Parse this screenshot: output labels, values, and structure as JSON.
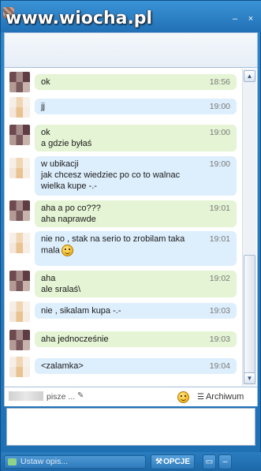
{
  "watermark": "www.wiocha.pl",
  "window_controls": {
    "minimize": "–",
    "close": "×"
  },
  "messages": [
    {
      "side": "a",
      "text": "ok",
      "time": "18:56",
      "color": "green"
    },
    {
      "side": "b",
      "text": "jj",
      "time": "19:00",
      "color": "blue"
    },
    {
      "side": "a",
      "text": "ok\na gdzie byłaś",
      "time": "19:00",
      "color": "green"
    },
    {
      "side": "b",
      "text": "w ubikacji\njak chcesz wiedziec po co to walnac\nwielka kupe -.-",
      "time": "19:00",
      "color": "blue"
    },
    {
      "side": "a",
      "text": "aha a po co???\naha naprawde",
      "time": "19:01",
      "color": "green"
    },
    {
      "side": "b",
      "text": "nie no , stak na serio to zrobilam taka\nmala",
      "time": "19:01",
      "color": "blue",
      "emoji": "smiley-icon"
    },
    {
      "side": "a",
      "text": "aha\nale sralaś\\",
      "time": "19:02",
      "color": "green"
    },
    {
      "side": "b",
      "text": "nie , sikalam kupa -.-",
      "time": "19:03",
      "color": "blue"
    },
    {
      "side": "a",
      "text": "aha jednocześnie",
      "time": "19:03",
      "color": "green"
    },
    {
      "side": "b",
      "text": "<zalamka>",
      "time": "19:04",
      "color": "blue"
    }
  ],
  "status_row": {
    "typing_text": "pisze ...",
    "archive_label": "Archiwum"
  },
  "bottom_bar": {
    "description_placeholder": "Ustaw opis...",
    "options_label": "OPCJE"
  },
  "colors": {
    "bubble_green": "#e4f4d4",
    "bubble_blue": "#ddeefc",
    "window_blue": "#2170b5"
  }
}
